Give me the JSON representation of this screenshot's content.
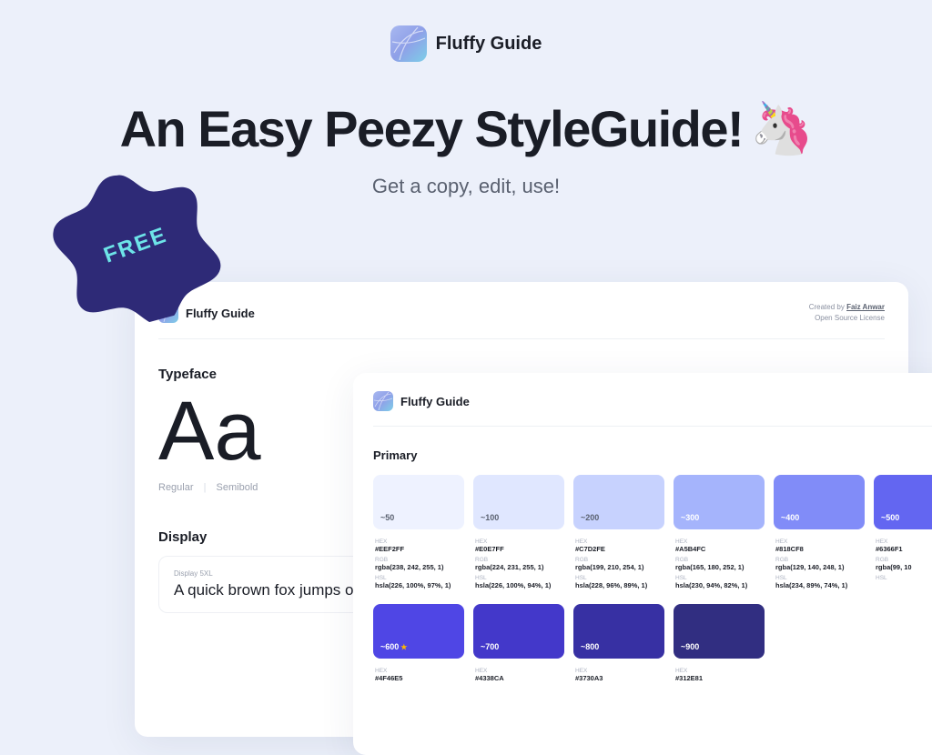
{
  "brand": "Fluffy Guide",
  "hero": {
    "title": "An Easy Peezy StyleGuide!",
    "emoji": "🦄",
    "subtitle": "Get a copy, edit, use!"
  },
  "badge": {
    "text": "FREE"
  },
  "panelBack": {
    "brand": "Fluffy Guide",
    "createdLabel": "Created by ",
    "createdBy": "Faiz Anwar",
    "license": "Open Source License",
    "typefaceTitle": "Typeface",
    "typefaceSample": "Aa",
    "weights": {
      "w1": "Regular",
      "w2": "Semibold"
    },
    "displayTitle": "Display",
    "displayLabel": "Display 5XL",
    "displaySample": "A quick brown fox jumps o"
  },
  "panelFront": {
    "brand": "Fluffy Guide",
    "sectionTitle": "Primary",
    "swatchesTop": [
      {
        "shade": "~50",
        "hex": "#EEF2FF",
        "rgb": "rgba(238, 242, 255, 1)",
        "hsl": "hsla(226, 100%, 97%, 1)",
        "tone": "light"
      },
      {
        "shade": "~100",
        "hex": "#E0E7FF",
        "rgb": "rgba(224, 231, 255, 1)",
        "hsl": "hsla(226, 100%, 94%, 1)",
        "tone": "light"
      },
      {
        "shade": "~200",
        "hex": "#C7D2FE",
        "rgb": "rgba(199, 210, 254, 1)",
        "hsl": "hsla(228, 96%, 89%, 1)",
        "tone": "light"
      },
      {
        "shade": "~300",
        "hex": "#A5B4FC",
        "rgb": "rgba(165, 180, 252, 1)",
        "hsl": "hsla(230, 94%, 82%, 1)",
        "tone": "dark"
      },
      {
        "shade": "~400",
        "hex": "#818CF8",
        "rgb": "rgba(129, 140, 248, 1)",
        "hsl": "hsla(234, 89%, 74%, 1)",
        "tone": "dark"
      },
      {
        "shade": "~500",
        "hex": "#6366F1",
        "rgb": "rgba(99, 10",
        "hsl": "",
        "tone": "dark"
      }
    ],
    "swatchesBottom": [
      {
        "shade": "~600",
        "hex": "#4F46E5",
        "star": true,
        "tone": "dark"
      },
      {
        "shade": "~700",
        "hex": "#4338CA",
        "star": false,
        "tone": "dark"
      },
      {
        "shade": "~800",
        "hex": "#3730A3",
        "star": false,
        "tone": "dark"
      },
      {
        "shade": "~900",
        "hex": "#312E81",
        "star": false,
        "tone": "dark"
      }
    ],
    "metaLabels": {
      "hex": "HEX",
      "rgb": "RGB",
      "hsl": "HSL"
    }
  }
}
